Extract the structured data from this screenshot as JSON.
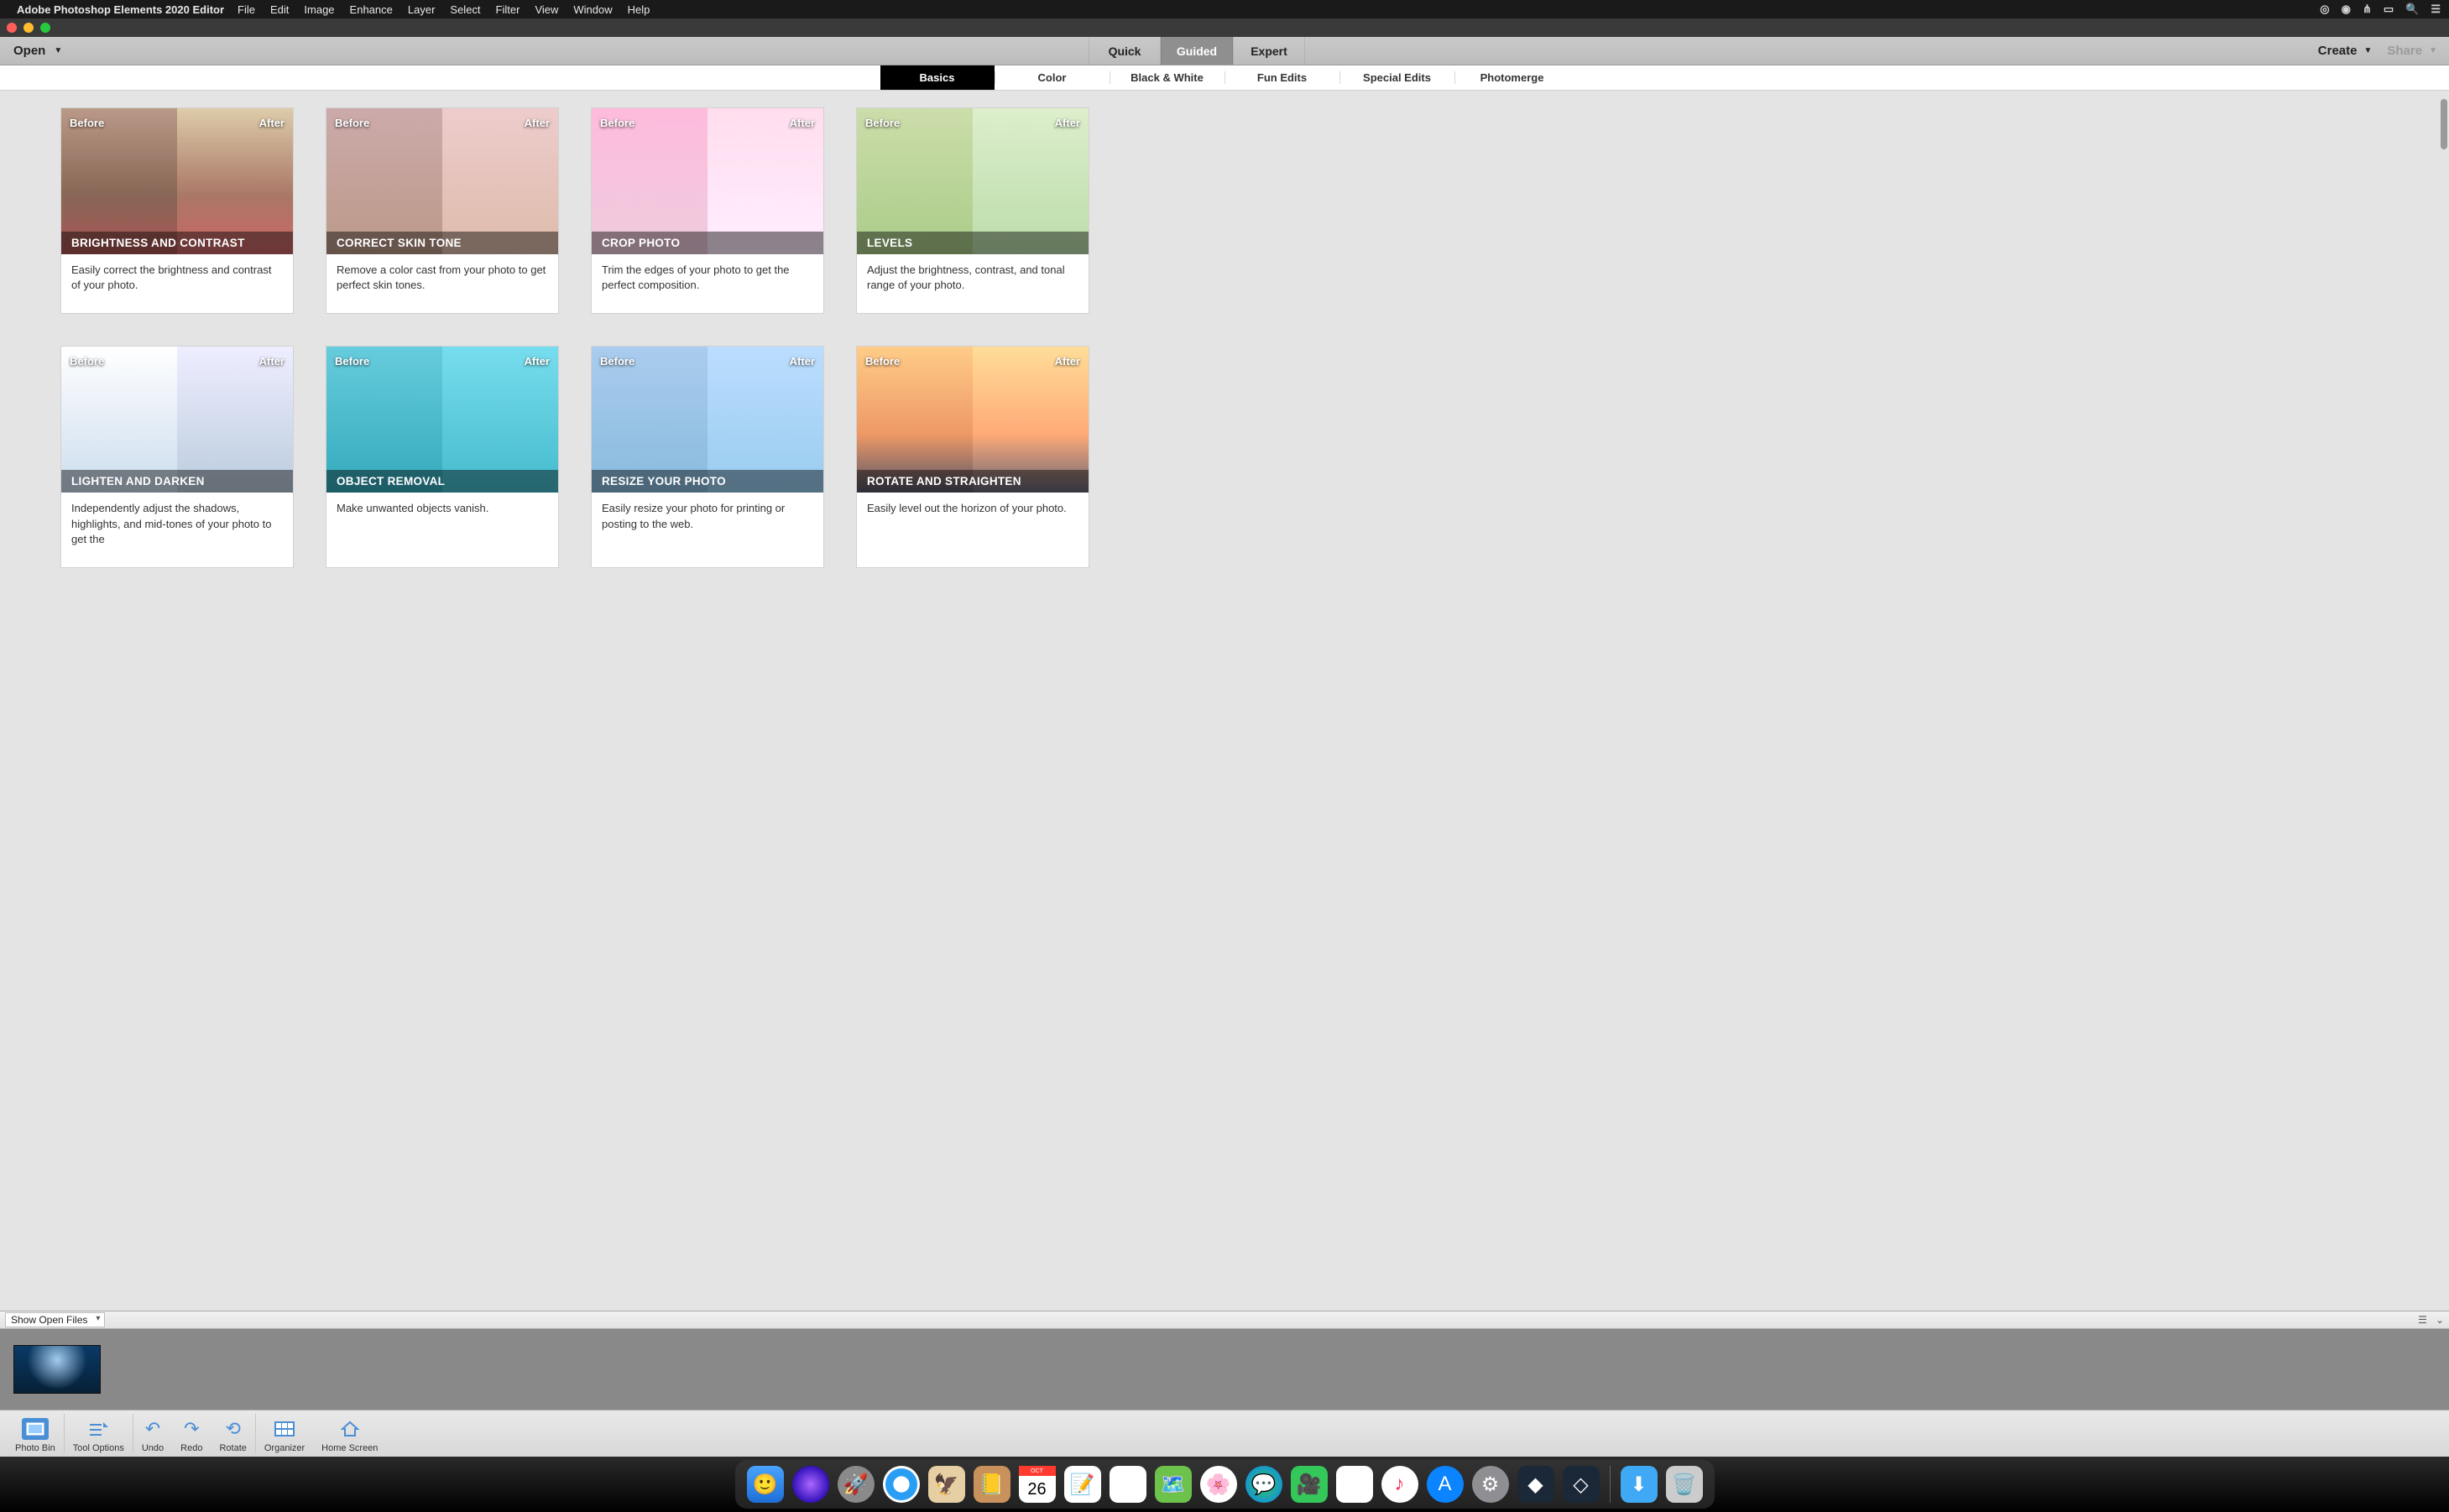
{
  "mac_menu": {
    "app_name": "Adobe Photoshop Elements 2020 Editor",
    "items": [
      "File",
      "Edit",
      "Image",
      "Enhance",
      "Layer",
      "Select",
      "Filter",
      "View",
      "Window",
      "Help"
    ]
  },
  "toolbar": {
    "open": "Open",
    "modes": [
      "Quick",
      "Guided",
      "Expert"
    ],
    "active_mode": "Guided",
    "create": "Create",
    "share": "Share"
  },
  "categories": {
    "items": [
      "Basics",
      "Color",
      "Black & White",
      "Fun Edits",
      "Special Edits",
      "Photomerge"
    ],
    "active": "Basics"
  },
  "labels": {
    "before": "Before",
    "after": "After"
  },
  "cards": [
    {
      "title": "BRIGHTNESS AND CONTRAST",
      "desc": "Easily correct the brightness and contrast of your photo."
    },
    {
      "title": "CORRECT SKIN TONE",
      "desc": "Remove a color cast from your photo to get perfect skin tones."
    },
    {
      "title": "CROP PHOTO",
      "desc": "Trim the edges of your photo to get the perfect composition."
    },
    {
      "title": "LEVELS",
      "desc": "Adjust the brightness, contrast, and tonal range of your photo."
    },
    {
      "title": "LIGHTEN AND DARKEN",
      "desc": "Independently adjust the shadows, highlights, and mid-tones of your photo to get the"
    },
    {
      "title": "OBJECT REMOVAL",
      "desc": "Make unwanted objects vanish."
    },
    {
      "title": "RESIZE YOUR PHOTO",
      "desc": "Easily resize your photo for printing or posting to the web."
    },
    {
      "title": "ROTATE AND STRAIGHTEN",
      "desc": "Easily level out the horizon of your photo."
    }
  ],
  "bin": {
    "dropdown": "Show Open Files"
  },
  "bottom_tools": {
    "items": [
      "Photo Bin",
      "Tool Options",
      "Undo",
      "Redo",
      "Rotate",
      "Organizer",
      "Home Screen"
    ]
  },
  "dock": {
    "items": [
      "finder",
      "siri",
      "launchpad",
      "safari",
      "mail",
      "contacts",
      "calendar",
      "notes",
      "reminders",
      "maps",
      "photos",
      "messages",
      "facetime",
      "news",
      "music",
      "appstore",
      "settings",
      "pse-organizer",
      "pse-editor"
    ],
    "calendar_day": "26",
    "calendar_month": "OCT",
    "right_items": [
      "downloads",
      "trash"
    ]
  }
}
